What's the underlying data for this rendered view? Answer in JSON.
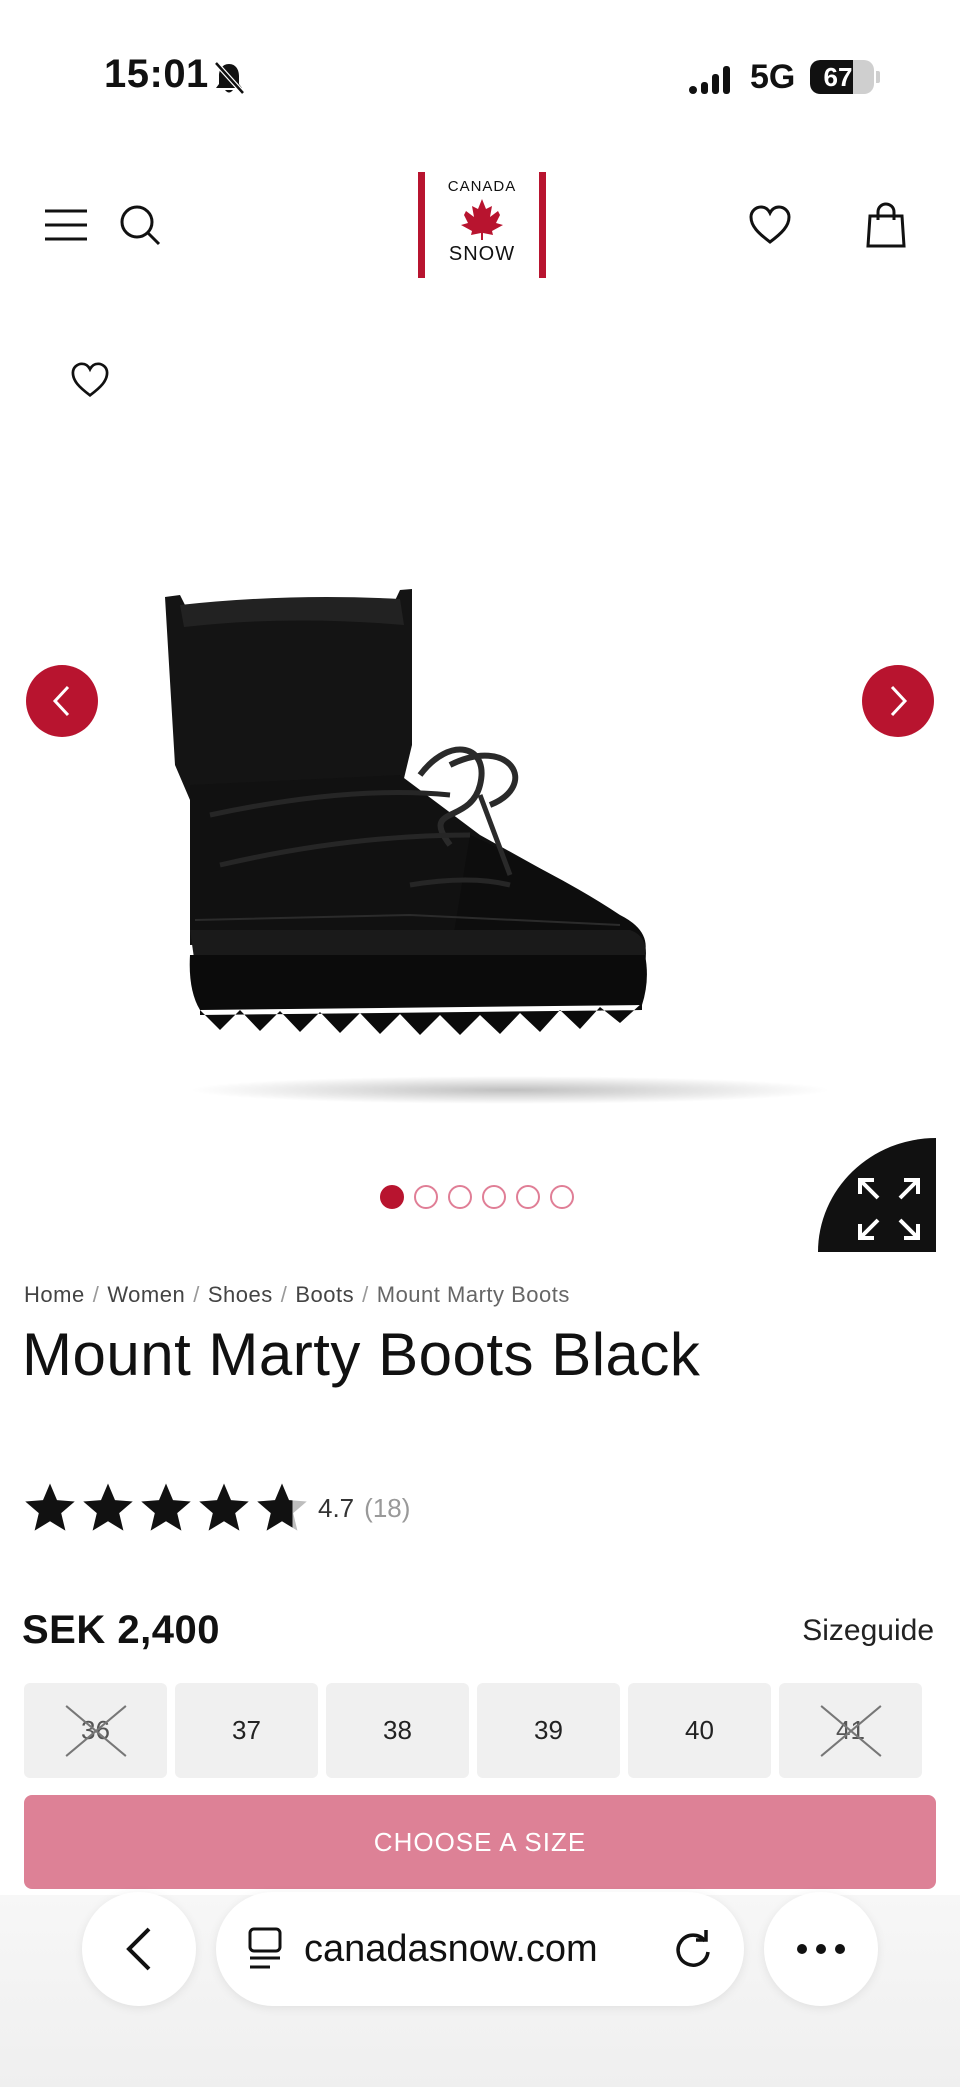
{
  "status_bar": {
    "time": "15:01",
    "network": "5G",
    "battery": "67",
    "battery_level": 0.67
  },
  "header": {
    "logo_top": "CANADA",
    "logo_bottom": "SNOW",
    "icons": [
      "menu-icon",
      "search-icon",
      "heart-icon",
      "shopping-bag-icon"
    ]
  },
  "gallery": {
    "image_count": 6,
    "active_index": 0
  },
  "breadcrumb": {
    "items": [
      "Home",
      "Women",
      "Shoes",
      "Boots"
    ],
    "current": "Mount Marty Boots",
    "separator": "/"
  },
  "product": {
    "title": "Mount Marty Boots Black",
    "rating": "4.7",
    "rating_value": 4.7,
    "review_count": "(18)",
    "price": "SEK 2,400",
    "sizeguide": "Sizeguide",
    "sizes": [
      {
        "label": "36",
        "available": false
      },
      {
        "label": "37",
        "available": true
      },
      {
        "label": "38",
        "available": true
      },
      {
        "label": "39",
        "available": true
      },
      {
        "label": "40",
        "available": true
      },
      {
        "label": "41",
        "available": false
      }
    ],
    "cta": "CHOOSE A SIZE"
  },
  "colors": {
    "brand_red": "#b8142f",
    "cta_pink": "#dd8196"
  },
  "browser": {
    "url": "canadasnow.com"
  }
}
